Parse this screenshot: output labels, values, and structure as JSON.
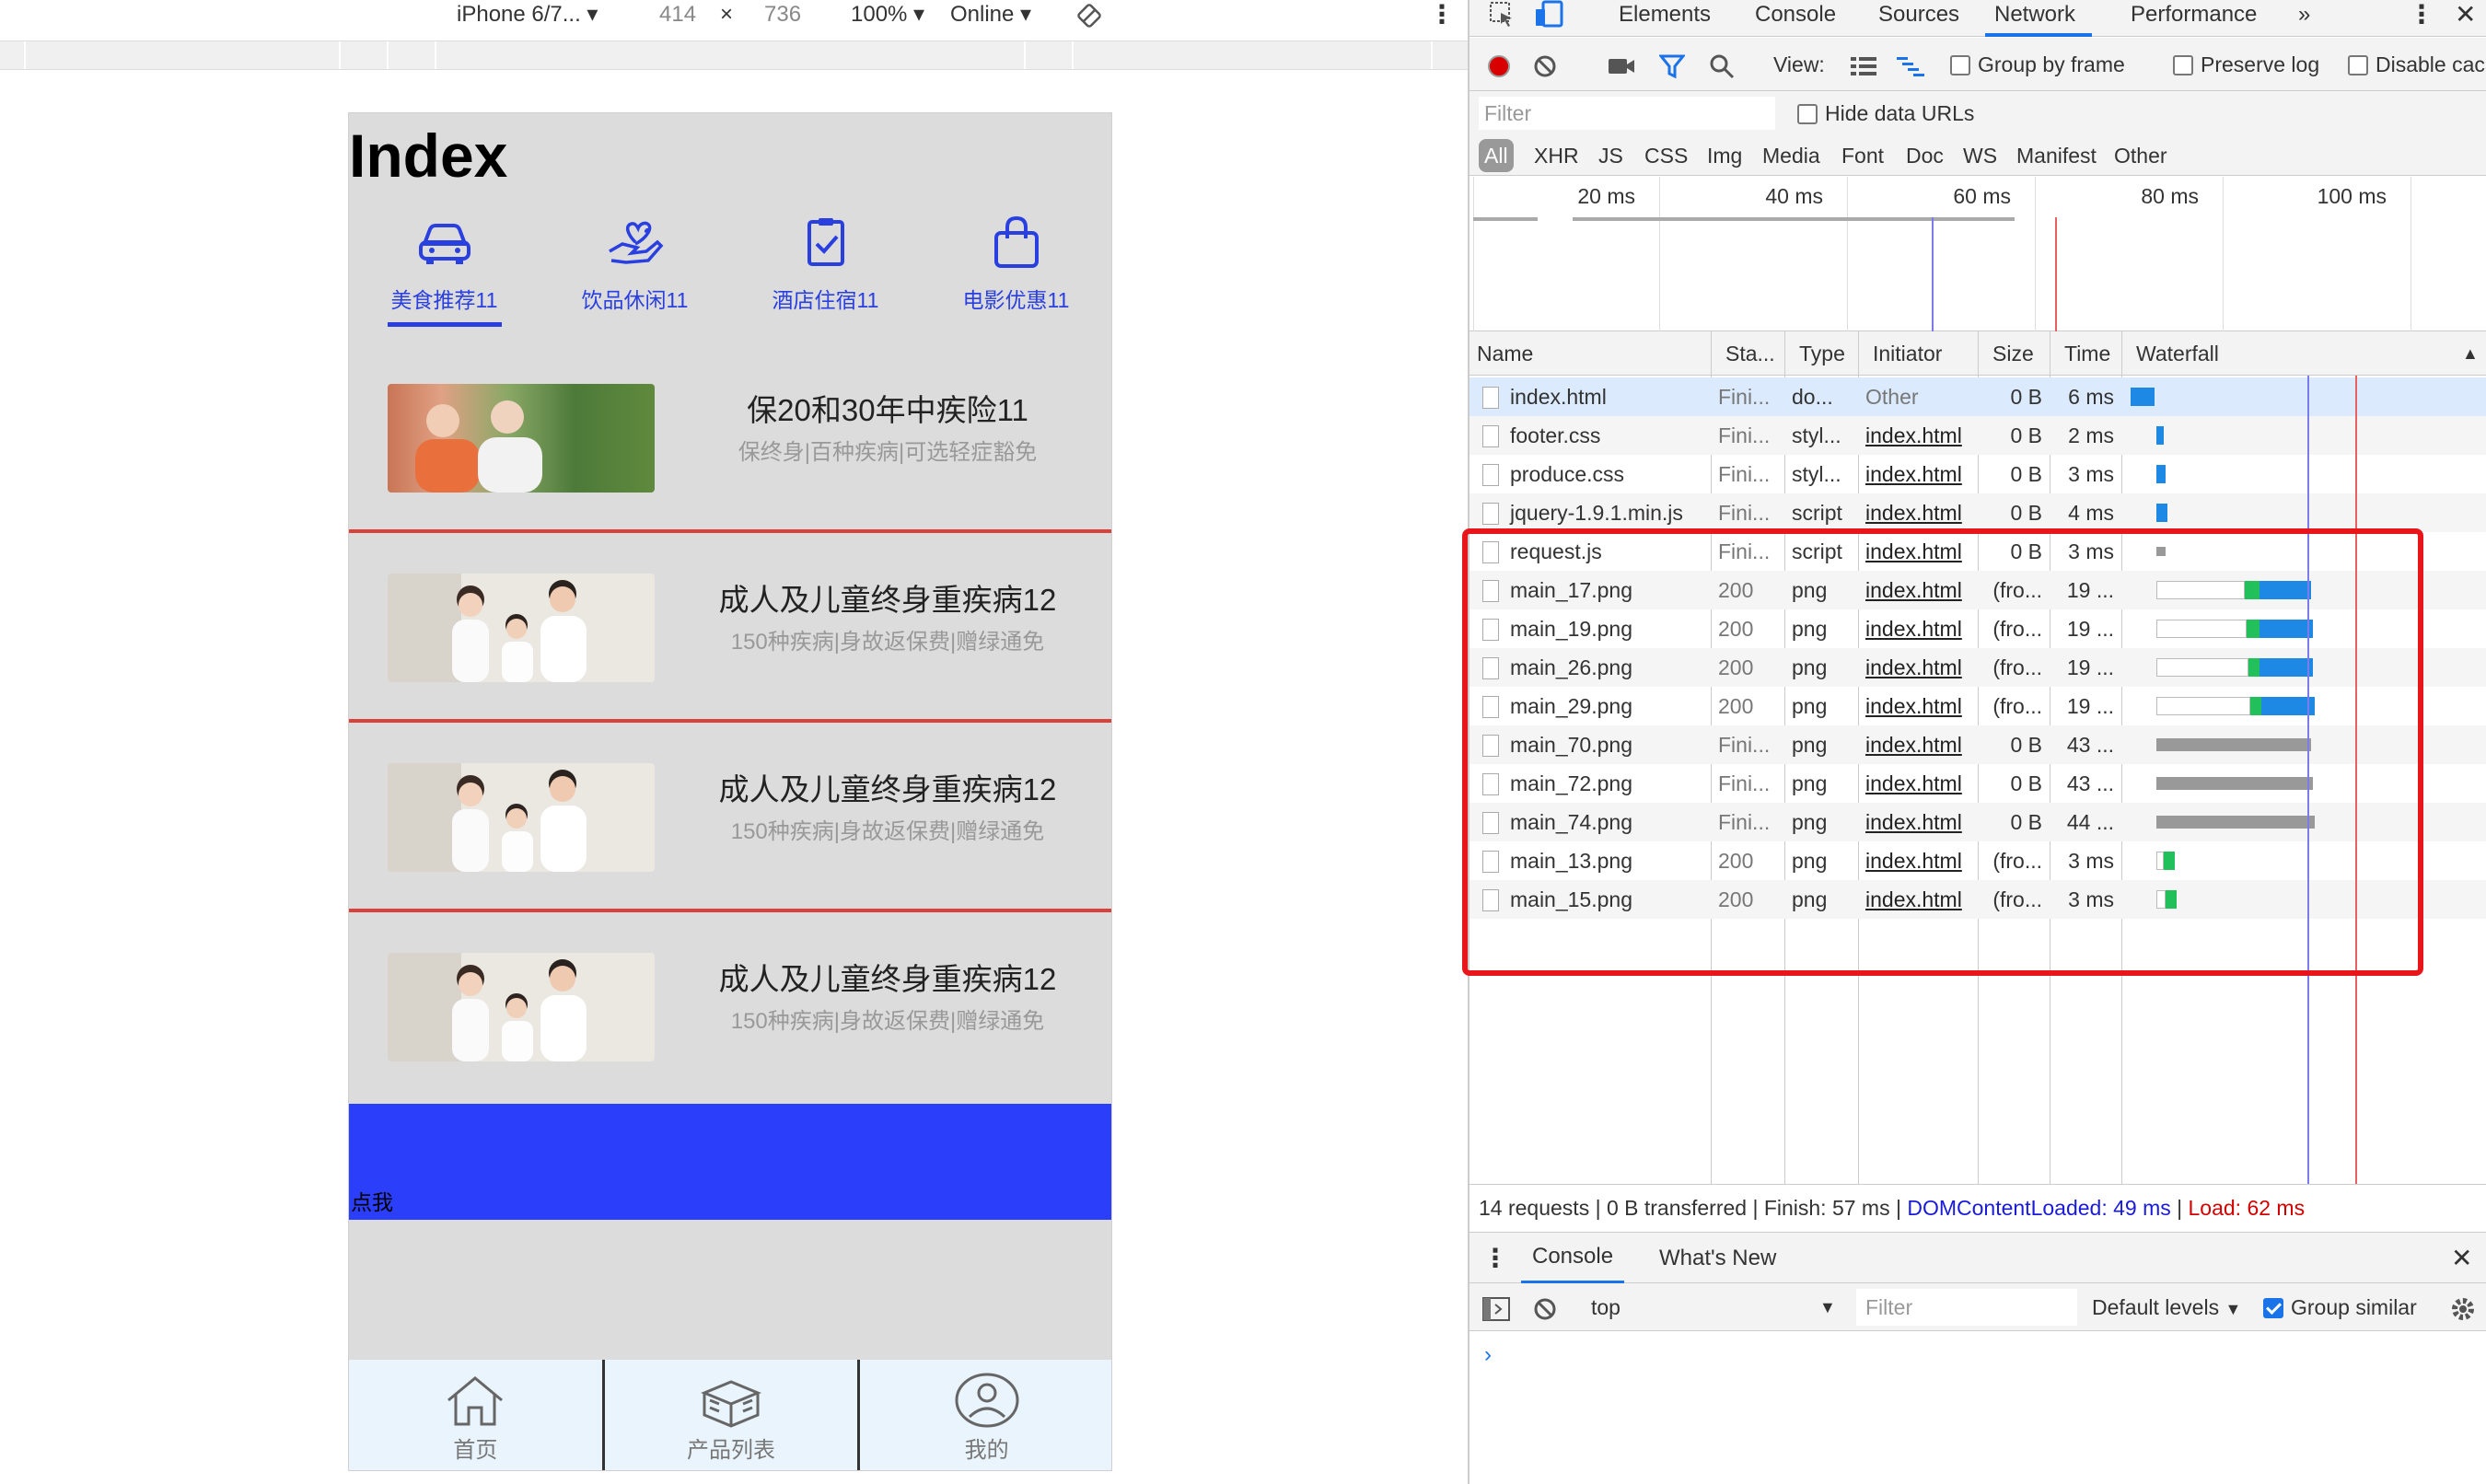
{
  "device_toolbar": {
    "device": "iPhone 6/7...",
    "width": "414",
    "times": "×",
    "height": "736",
    "zoom": "100%",
    "network": "Online"
  },
  "phone": {
    "title": "Index",
    "categories": [
      {
        "label": "美食推荐11",
        "icon": "car-icon",
        "active": true
      },
      {
        "label": "饮品休闲11",
        "icon": "heart-hand-icon",
        "active": false
      },
      {
        "label": "酒店住宿11",
        "icon": "clipboard-check-icon",
        "active": false
      },
      {
        "label": "电影优惠11",
        "icon": "shopping-bag-icon",
        "active": false
      }
    ],
    "products": [
      {
        "title": "保20和30年中疾险11",
        "subtitle": "保终身|百种疾病|可选轻症豁免"
      },
      {
        "title": "成人及儿童终身重疾病12",
        "subtitle": "150种疾病|身故返保费|赠绿通免"
      },
      {
        "title": "成人及儿童终身重疾病12",
        "subtitle": "150种疾病|身故返保费|赠绿通免"
      },
      {
        "title": "成人及儿童终身重疾病12",
        "subtitle": "150种疾病|身故返保费|赠绿通免"
      }
    ],
    "button_label": "点我",
    "tabbar": [
      {
        "label": "首页",
        "icon": "home-icon"
      },
      {
        "label": "产品列表",
        "icon": "box-icon"
      },
      {
        "label": "我的",
        "icon": "user-icon"
      }
    ],
    "colors": {
      "accent": "#2a3fe0",
      "button": "#2b3ef9",
      "separator": "#d9423a",
      "background": "#dcdcdc"
    }
  },
  "devtools": {
    "tabs": [
      "Elements",
      "Console",
      "Sources",
      "Network",
      "Performance",
      "»"
    ],
    "active_tab": "Network",
    "toolbar": {
      "view_label": "View:",
      "group_by_frame": "Group by frame",
      "preserve_log": "Preserve log",
      "disable_cache": "Disable cac"
    },
    "filter_placeholder": "Filter",
    "hide_data_urls": "Hide data URLs",
    "types": [
      "All",
      "XHR",
      "JS",
      "CSS",
      "Img",
      "Media",
      "Font",
      "Doc",
      "WS",
      "Manifest",
      "Other"
    ],
    "overview_ticks": [
      "20 ms",
      "40 ms",
      "60 ms",
      "80 ms",
      "100 ms"
    ],
    "columns": [
      "Name",
      "Sta...",
      "Type",
      "Initiator",
      "Size",
      "Time",
      "Waterfall"
    ],
    "requests": [
      {
        "name": "index.html",
        "status": "Fini...",
        "type": "do...",
        "initiator": "Other",
        "size": "0 B",
        "time": "6 ms"
      },
      {
        "name": "footer.css",
        "status": "Fini...",
        "type": "styl...",
        "initiator": "index.html",
        "size": "0 B",
        "time": "2 ms"
      },
      {
        "name": "produce.css",
        "status": "Fini...",
        "type": "styl...",
        "initiator": "index.html",
        "size": "0 B",
        "time": "3 ms"
      },
      {
        "name": "jquery-1.9.1.min.js",
        "status": "Fini...",
        "type": "script",
        "initiator": "index.html",
        "size": "0 B",
        "time": "4 ms"
      },
      {
        "name": "request.js",
        "status": "Fini...",
        "type": "script",
        "initiator": "index.html",
        "size": "0 B",
        "time": "3 ms"
      },
      {
        "name": "main_17.png",
        "status": "200",
        "type": "png",
        "initiator": "index.html",
        "size": "(fro...",
        "time": "19 ..."
      },
      {
        "name": "main_19.png",
        "status": "200",
        "type": "png",
        "initiator": "index.html",
        "size": "(fro...",
        "time": "19 ..."
      },
      {
        "name": "main_26.png",
        "status": "200",
        "type": "png",
        "initiator": "index.html",
        "size": "(fro...",
        "time": "19 ..."
      },
      {
        "name": "main_29.png",
        "status": "200",
        "type": "png",
        "initiator": "index.html",
        "size": "(fro...",
        "time": "19 ..."
      },
      {
        "name": "main_70.png",
        "status": "Fini...",
        "type": "png",
        "initiator": "index.html",
        "size": "0 B",
        "time": "43 ..."
      },
      {
        "name": "main_72.png",
        "status": "Fini...",
        "type": "png",
        "initiator": "index.html",
        "size": "0 B",
        "time": "43 ..."
      },
      {
        "name": "main_74.png",
        "status": "Fini...",
        "type": "png",
        "initiator": "index.html",
        "size": "0 B",
        "time": "44 ..."
      },
      {
        "name": "main_13.png",
        "status": "200",
        "type": "png",
        "initiator": "index.html",
        "size": "(fro...",
        "time": "3 ms"
      },
      {
        "name": "main_15.png",
        "status": "200",
        "type": "png",
        "initiator": "index.html",
        "size": "(fro...",
        "time": "3 ms"
      }
    ],
    "status": {
      "summary": "14 requests | 0 B transferred | Finish: 57 ms |",
      "dom_content_loaded": "DOMContentLoaded: 49 ms",
      "separator": "|",
      "load": "Load: 62 ms"
    },
    "console": {
      "tabs": [
        "Console",
        "What's New"
      ],
      "context": "top",
      "filter_placeholder": "Filter",
      "levels": "Default levels",
      "group_similar": "Group similar",
      "prompt": "›"
    }
  }
}
